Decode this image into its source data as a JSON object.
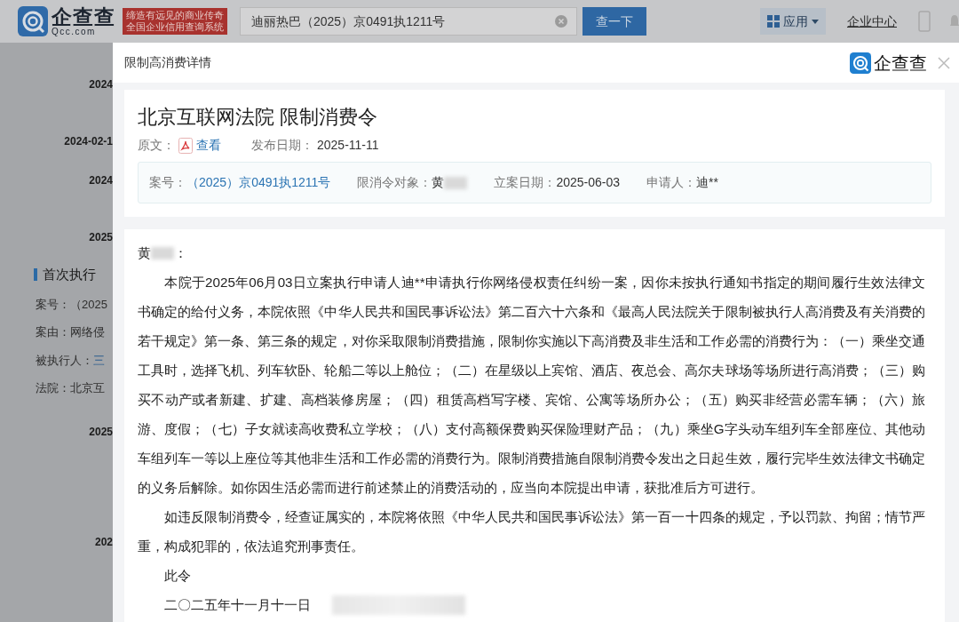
{
  "header": {
    "logo": {
      "name": "企查查",
      "domain": "Qcc.com"
    },
    "slogan": [
      "缔造有远见的商业传奇",
      "全国企业信用查询系统"
    ],
    "search": {
      "value": "迪丽热巴（2025）京0491执1211号"
    },
    "search_button": "查一下",
    "apps_menu": "应用",
    "enterprise_center": "企业中心"
  },
  "background": [
    {
      "kind": "date",
      "text": "2024"
    },
    {
      "kind": "date",
      "text": "2024-02-1"
    },
    {
      "kind": "date",
      "text": "2024"
    },
    {
      "kind": "date",
      "text": "2025"
    },
    {
      "kind": "heading",
      "text": "首次执行"
    },
    {
      "kind": "field",
      "label": "案号：",
      "value": "（2025",
      "link": false
    },
    {
      "kind": "field",
      "label": "案由：",
      "value": "网络侵",
      "link": false
    },
    {
      "kind": "field",
      "label": "被执行人：",
      "value": "三",
      "link": true
    },
    {
      "kind": "field",
      "label": "法院：",
      "value": "北京互",
      "link": false
    },
    {
      "kind": "date",
      "text": "2025"
    },
    {
      "kind": "date",
      "text": "202"
    }
  ],
  "modal": {
    "title": "限制高消费详情",
    "brand": "企查查",
    "document": {
      "title": "北京互联网法院 限制消费令",
      "original_label": "原文：",
      "view_link": "查看",
      "publish_label": "发布日期：",
      "publish_date": "2025-11-11",
      "info": [
        {
          "label": "案号：",
          "value": "（2025）京0491执1211号",
          "kind": "link",
          "redacted": false
        },
        {
          "label": "限消令对象：",
          "value": "黄",
          "kind": "text",
          "redacted": true
        },
        {
          "label": "立案日期：",
          "value": "2025-06-03",
          "kind": "text",
          "redacted": false
        },
        {
          "label": "申请人：",
          "value": "迪**",
          "kind": "text",
          "redacted": false
        }
      ]
    },
    "letter": {
      "salutation": {
        "name": "黄",
        "redacted": true,
        "punct": "："
      },
      "paragraphs": [
        "本院于2025年06月03日立案执行申请人迪**申请执行你网络侵权责任纠纷一案，因你未按执行通知书指定的期间履行生效法律文书确定的给付义务，本院依照《中华人民共和国民事诉讼法》第二百六十六条和《最高人民法院关于限制被执行人高消费及有关消费的若干规定》第一条、第三条的规定，对你采取限制消费措施，限制你实施以下高消费及非生活和工作必需的消费行为：（一）乘坐交通工具时，选择飞机、列车软卧、轮船二等以上舱位；（二）在星级以上宾馆、酒店、夜总会、高尔夫球场等场所进行高消费；（三）购买不动产或者新建、扩建、高档装修房屋；（四）租赁高档写字楼、宾馆、公寓等场所办公；（五）购买非经营必需车辆；（六）旅游、度假；（七）子女就读高收费私立学校；（八）支付高额保费购买保险理财产品；（九）乘坐G字头动车组列车全部座位、其他动车组列车一等以上座位等其他非生活和工作必需的消费行为。限制消费措施自限制消费令发出之日起生效，履行完毕生效法律文书确定的义务后解除。如你因生活必需而进行前述禁止的消费活动的，应当向本院提出申请，获批准后方可进行。",
        "如违反限制消费令，经查证属实的，本院将依照《中华人民共和国民事诉讼法》第一百一十四条的规定，予以罚款、拘留；情节严重，构成犯罪的，依法追究刑事责任。"
      ],
      "closing": "此令",
      "date": "二〇二五年十一月十一日"
    }
  }
}
